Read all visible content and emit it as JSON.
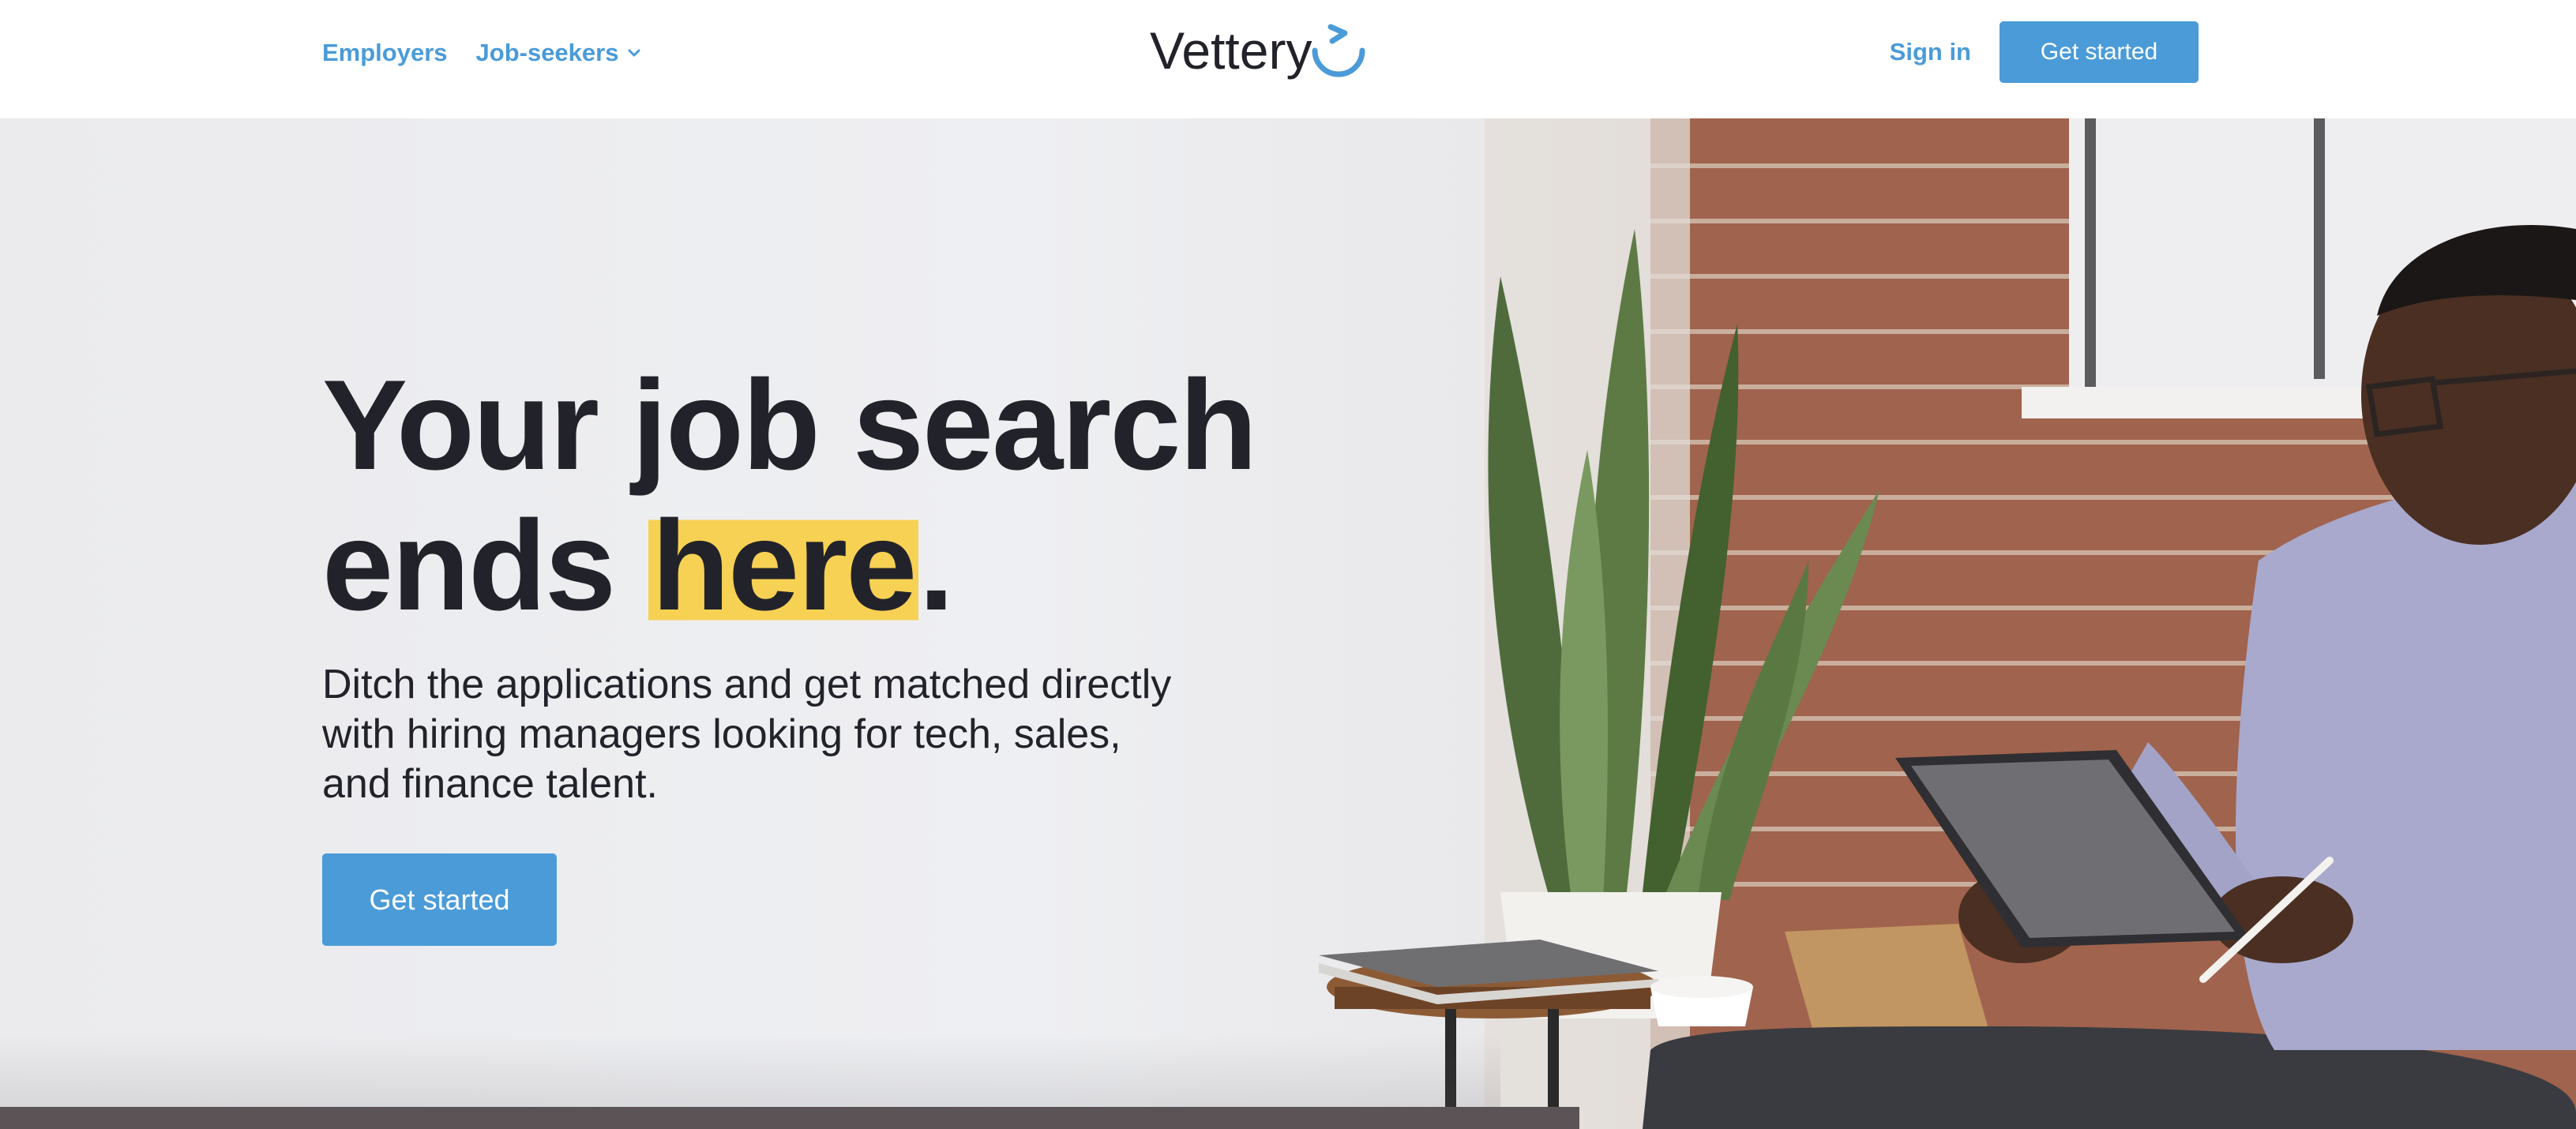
{
  "header": {
    "nav": {
      "employers": "Employers",
      "job_seekers": "Job-seekers"
    },
    "logo_text": "Vettery",
    "sign_in": "Sign in",
    "get_started": "Get started"
  },
  "hero": {
    "headline_line1": "Your job search",
    "headline_ends": "ends ",
    "headline_highlight": "here",
    "headline_period": ".",
    "subtext": "Ditch the applications and get matched directly with hiring managers looking for tech, sales, and finance talent.",
    "cta": "Get started"
  },
  "colors": {
    "accent": "#4a9bd8",
    "highlight": "#f7d154",
    "text": "#22232a"
  },
  "icons": {
    "job_seekers_dropdown": "chevron-down-icon",
    "logo_mark": "smile-arrow-icon"
  }
}
